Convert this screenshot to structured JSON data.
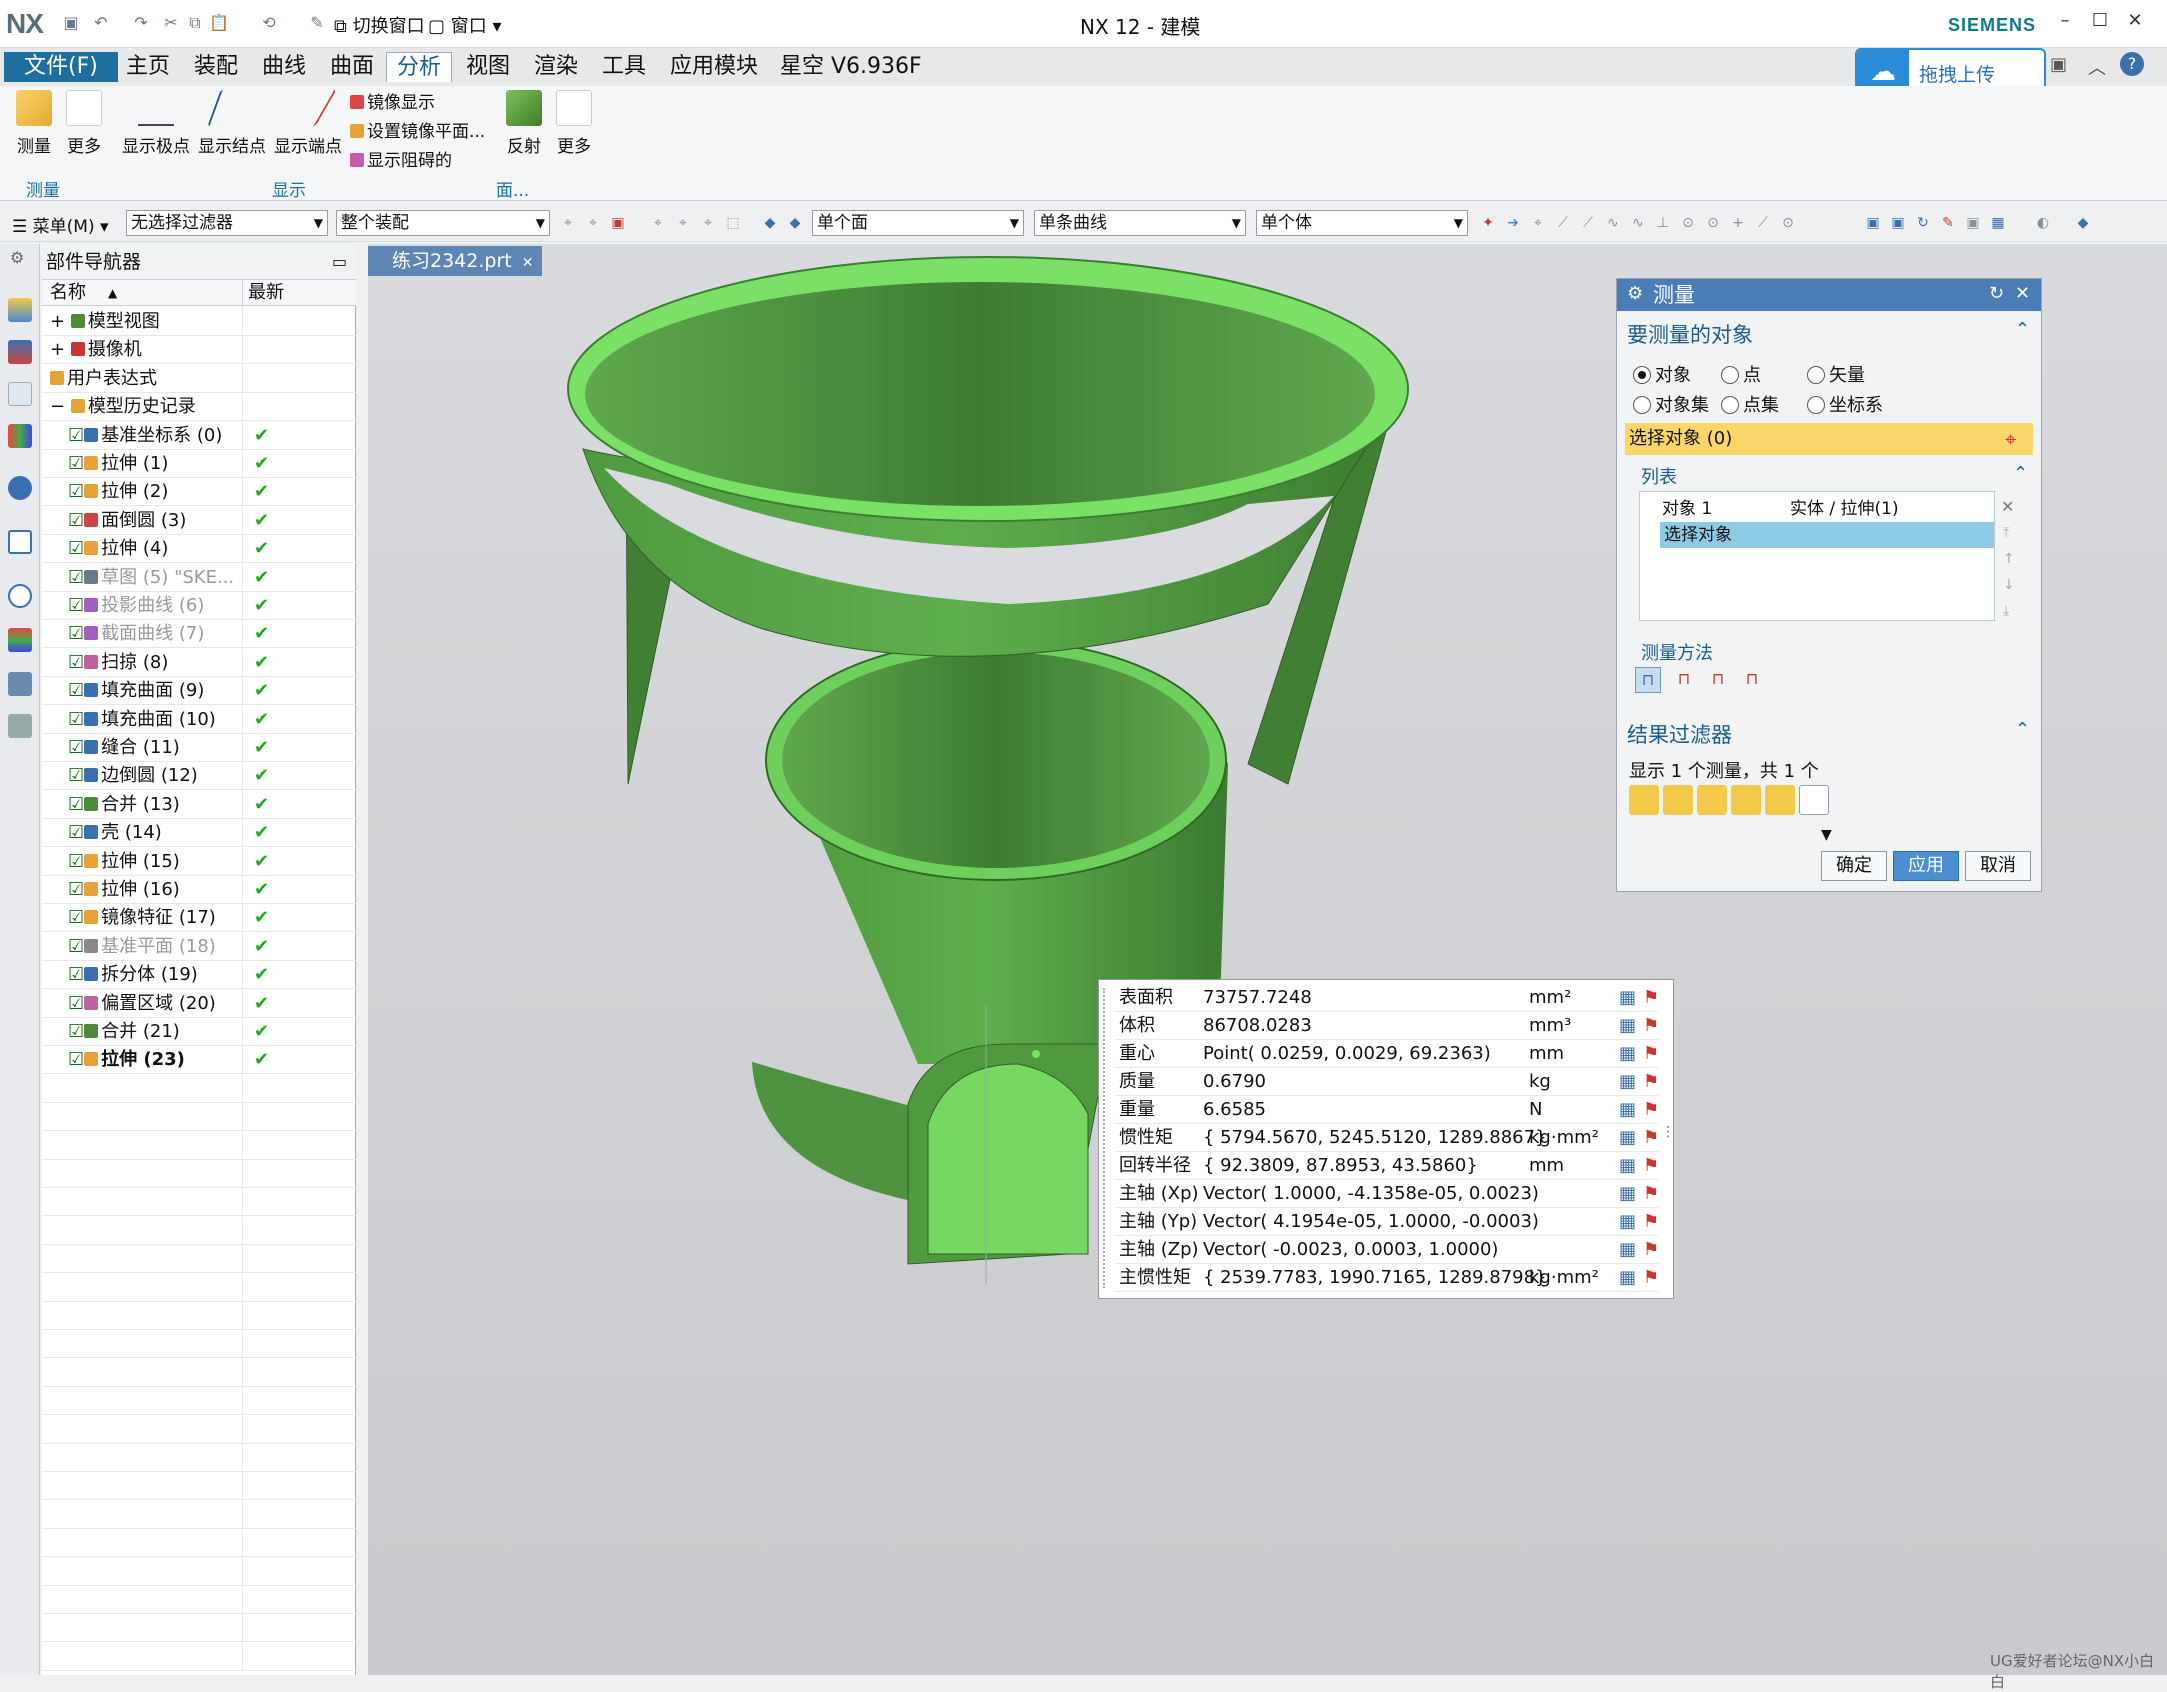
{
  "window": {
    "title": "NX 12 - 建模",
    "brand": "SIEMENS",
    "logo": "NX"
  },
  "quick_access": {
    "switch_window": "切换窗口",
    "window": "窗口"
  },
  "menubar": {
    "file": "文件(F)",
    "tabs": [
      "主页",
      "装配",
      "曲线",
      "曲面",
      "分析",
      "视图",
      "渲染",
      "工具",
      "应用模块",
      "星空 V6.936F"
    ],
    "active_tab": "分析"
  },
  "upload": {
    "label": "拖拽上传"
  },
  "ribbon": {
    "measure": "测量",
    "more": "更多",
    "show_pole": "显示极点",
    "show_knot": "显示结点",
    "show_endpoint": "显示端点",
    "mirror_display": "镜像显示",
    "set_mirror_plane": "设置镜像平面...",
    "show_block": "显示阻碍的",
    "reflect": "反射",
    "more2": "更多",
    "group_measure": "测量",
    "group_display": "显示",
    "group_face": "面..."
  },
  "filterbar": {
    "menu": "菜单(M)",
    "filter": "无选择过滤器",
    "assembly": "整个装配",
    "face": "单个面",
    "curve": "单条曲线",
    "body": "单个体"
  },
  "navigator": {
    "title": "部件导航器",
    "col_name": "名称",
    "col_latest": "最新",
    "items": [
      {
        "label": "模型视图"
      },
      {
        "label": "摄像机"
      },
      {
        "label": "用户表达式"
      },
      {
        "label": "模型历史记录"
      },
      {
        "label": "基准坐标系 (0)"
      },
      {
        "label": "拉伸 (1)"
      },
      {
        "label": "拉伸 (2)"
      },
      {
        "label": "面倒圆 (3)"
      },
      {
        "label": "拉伸 (4)"
      },
      {
        "label": "草图 (5) \"SKE..."
      },
      {
        "label": "投影曲线 (6)"
      },
      {
        "label": "截面曲线 (7)"
      },
      {
        "label": "扫掠 (8)"
      },
      {
        "label": "填充曲面 (9)"
      },
      {
        "label": "填充曲面 (10)"
      },
      {
        "label": "缝合 (11)"
      },
      {
        "label": "边倒圆 (12)"
      },
      {
        "label": "合并 (13)"
      },
      {
        "label": "壳 (14)"
      },
      {
        "label": "拉伸 (15)"
      },
      {
        "label": "拉伸 (16)"
      },
      {
        "label": "镜像特征 (17)"
      },
      {
        "label": "基准平面 (18)"
      },
      {
        "label": "拆分体 (19)"
      },
      {
        "label": "偏置区域 (20)"
      },
      {
        "label": "合并 (21)"
      },
      {
        "label": "拉伸 (23)"
      }
    ]
  },
  "doc_tab": {
    "label": "练习2342.prt"
  },
  "measure": {
    "title": "测量",
    "objects_section": "要测量的对象",
    "radio": [
      "对象",
      "点",
      "矢量",
      "对象集",
      "点集",
      "坐标系"
    ],
    "selected_radio": "对象",
    "select_object": "选择对象 (0)",
    "list_section": "列表",
    "list_row1_a": "对象 1",
    "list_row1_b": "实体 / 拉伸(1)",
    "list_row2": "选择对象",
    "method_section": "测量方法",
    "filter_section": "结果过滤器",
    "filter_summary": "显示 1 个测量，共 1 个",
    "ok": "确定",
    "apply": "应用",
    "cancel": "取消"
  },
  "results": [
    {
      "name": "表面积",
      "value": "73757.7248",
      "unit": "mm²"
    },
    {
      "name": "体积",
      "value": "86708.0283",
      "unit": "mm³"
    },
    {
      "name": "重心",
      "value": "Point( 0.0259, 0.0029, 69.2363)",
      "unit": "mm"
    },
    {
      "name": "质量",
      "value": "0.6790",
      "unit": "kg"
    },
    {
      "name": "重量",
      "value": "6.6585",
      "unit": "N"
    },
    {
      "name": "惯性矩",
      "value": "{ 5794.5670, 5245.5120, 1289.8867}",
      "unit": "kg·mm²"
    },
    {
      "name": "回转半径",
      "value": "{ 92.3809, 87.8953, 43.5860}",
      "unit": "mm"
    },
    {
      "name": "主轴 (Xp)",
      "value": "Vector( 1.0000, -4.1358e-05, 0.0023)",
      "unit": ""
    },
    {
      "name": "主轴 (Yp)",
      "value": "Vector( 4.1954e-05, 1.0000, -0.0003)",
      "unit": ""
    },
    {
      "name": "主轴 (Zp)",
      "value": "Vector( -0.0023, 0.0003, 1.0000)",
      "unit": ""
    },
    {
      "name": "主惯性矩",
      "value": "{ 2539.7783, 1990.7165, 1289.8798}",
      "unit": "kg·mm²"
    }
  ],
  "watermark": "UG爱好者论坛@NX小白白",
  "colors": {
    "accent": "#1d6f9e",
    "model_green": "#6fcf5c",
    "selection_yellow": "#fbd66a",
    "check_green": "#22aa22"
  }
}
